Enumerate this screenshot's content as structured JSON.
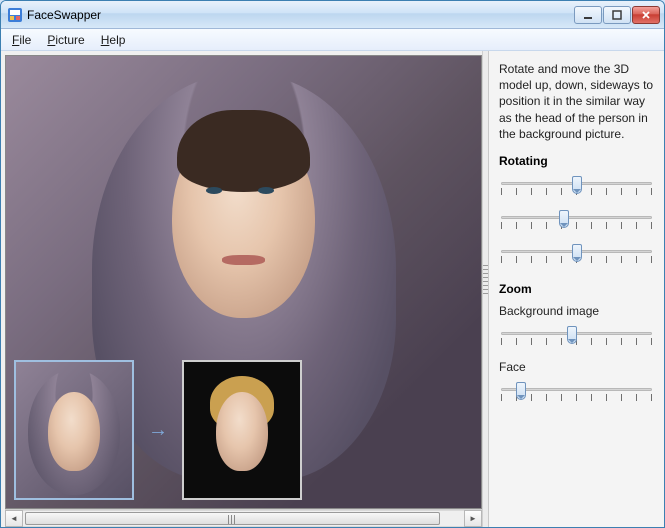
{
  "window": {
    "title": "FaceSwapper"
  },
  "menu": {
    "file": "File",
    "picture": "Picture",
    "help": "Help"
  },
  "sidebar": {
    "help_text": "Rotate and move the 3D model up, down, sideways to position it in the similar way as the head of the person in the background picture.",
    "rotating_title": "Rotating",
    "zoom_title": "Zoom",
    "bg_label": "Background image",
    "face_label": "Face"
  },
  "sliders": {
    "rotate1": {
      "value_pct": 50,
      "ticks": 11
    },
    "rotate2": {
      "value_pct": 42,
      "ticks": 11
    },
    "rotate3": {
      "value_pct": 50,
      "ticks": 11
    },
    "zoom_bg": {
      "value_pct": 47,
      "ticks": 11
    },
    "zoom_face": {
      "value_pct": 14,
      "ticks": 11
    }
  },
  "icons": {
    "app": "app-icon",
    "minimize": "minimize-icon",
    "maximize": "maximize-icon",
    "close": "close-icon",
    "left_arrow": "◄",
    "right_arrow": "►",
    "between_arrow": "→"
  }
}
